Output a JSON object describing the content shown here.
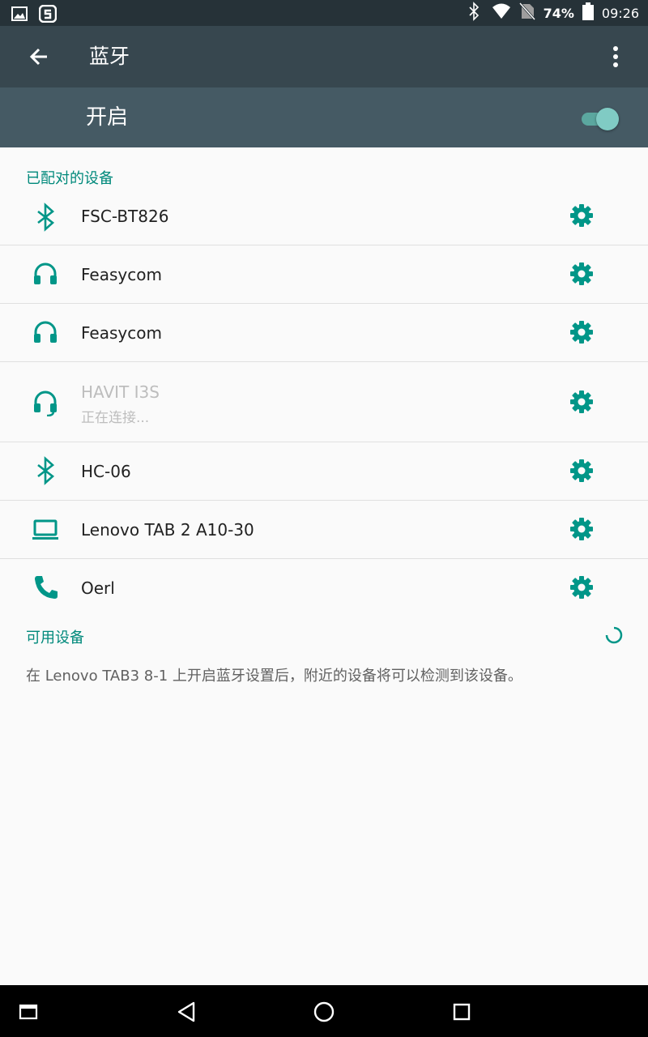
{
  "status_bar": {
    "battery": "74%",
    "time": "09:26",
    "icons": [
      "image-icon",
      "s-app-icon",
      "bluetooth-icon",
      "wifi-icon",
      "no-sim-icon",
      "battery-icon"
    ]
  },
  "app_bar": {
    "title": "蓝牙",
    "back_icon": "arrow-back-icon",
    "menu_icon": "more-vert-icon"
  },
  "bluetooth_switch": {
    "label": "开启",
    "on": true
  },
  "paired_section": {
    "header": "已配对的设备",
    "devices": [
      {
        "name": "FSC-BT826",
        "icon": "bluetooth-icon",
        "status": ""
      },
      {
        "name": "Feasycom",
        "icon": "headphones-icon",
        "status": ""
      },
      {
        "name": "Feasycom",
        "icon": "headphones-icon",
        "status": ""
      },
      {
        "name": "HAVIT I3S",
        "icon": "headset-mic-icon",
        "status": "正在连接..."
      },
      {
        "name": "HC-06",
        "icon": "bluetooth-icon",
        "status": ""
      },
      {
        "name": "Lenovo TAB 2 A10-30",
        "icon": "laptop-icon",
        "status": ""
      },
      {
        "name": "Oerl",
        "icon": "phone-icon",
        "status": ""
      }
    ]
  },
  "available_section": {
    "header": "可用设备",
    "hint": "在 Lenovo TAB3 8-1 上开启蓝牙设置后，附近的设备将可以检测到该设备。"
  },
  "nav_bar": {
    "icons": [
      "recents-window-icon",
      "back-triangle-icon",
      "home-circle-icon",
      "overview-square-icon"
    ]
  },
  "colors": {
    "accent": "#009688",
    "app_bar": "#37474f",
    "switch_bar": "#455a64",
    "status_bar": "#263238"
  }
}
